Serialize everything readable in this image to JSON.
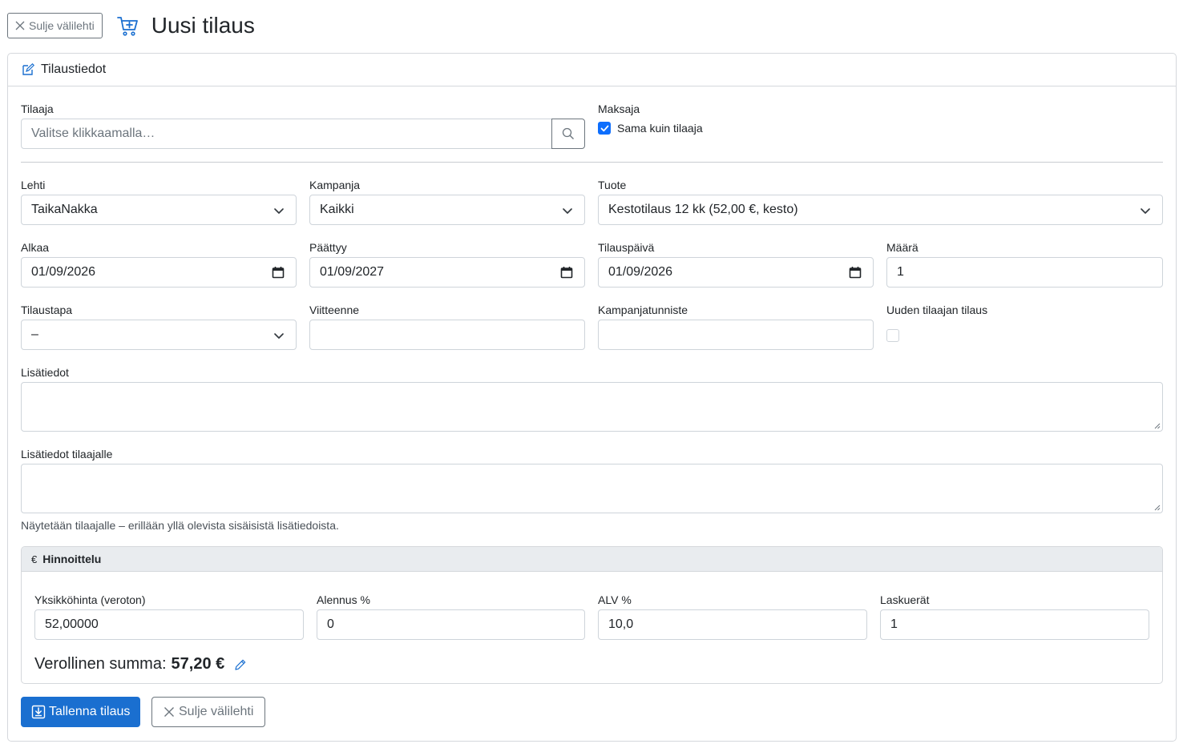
{
  "header": {
    "close_tab_label": "Sulje välilehti",
    "title": "Uusi tilaus"
  },
  "card": {
    "title": "Tilaustiedot"
  },
  "orderer": {
    "label": "Tilaaja",
    "placeholder": "Valitse klikkaamalla…"
  },
  "payer": {
    "label": "Maksaja",
    "same_as_orderer_label": "Sama kuin tilaaja",
    "same_as_orderer_checked": true
  },
  "fields": {
    "magazine": {
      "label": "Lehti",
      "value": "TaikaNakka"
    },
    "campaign": {
      "label": "Kampanja",
      "value": "Kaikki"
    },
    "product": {
      "label": "Tuote",
      "value": "Kestotilaus 12 kk (52,00 €, kesto)"
    },
    "start": {
      "label": "Alkaa",
      "value": "01/09/2026"
    },
    "end": {
      "label": "Päättyy",
      "value": "01/09/2027"
    },
    "order_date": {
      "label": "Tilauspäivä",
      "value": "01/09/2026"
    },
    "quantity": {
      "label": "Määrä",
      "value": "1"
    },
    "order_method": {
      "label": "Tilaustapa",
      "value": "–"
    },
    "reference": {
      "label": "Viitteenne",
      "value": ""
    },
    "campaign_code": {
      "label": "Kampanjatunniste",
      "value": ""
    },
    "new_subscriber": {
      "label": "Uuden tilaajan tilaus",
      "checked": false
    },
    "notes": {
      "label": "Lisätiedot",
      "value": ""
    },
    "notes_for_orderer": {
      "label": "Lisätiedot tilaajalle",
      "value": "",
      "help": "Näytetään tilaajalle – erillään yllä olevista sisäisistä lisätiedoista."
    }
  },
  "pricing": {
    "title": "Hinnoittelu",
    "currency_symbol": "€",
    "unit_price": {
      "label": "Yksikköhinta (veroton)",
      "value": "52,00000"
    },
    "discount": {
      "label": "Alennus %",
      "value": "0"
    },
    "vat": {
      "label": "ALV %",
      "value": "10,0"
    },
    "installments": {
      "label": "Laskuerät",
      "value": "1"
    },
    "total_label": "Verollinen summa:",
    "total_value": "57,20 €"
  },
  "actions": {
    "save_label": "Tallenna tilaus",
    "close_label": "Sulje välilehti"
  },
  "colors": {
    "primary": "#1a6fd0",
    "checkbox": "#0d6efd",
    "secondary": "#6c757d"
  }
}
